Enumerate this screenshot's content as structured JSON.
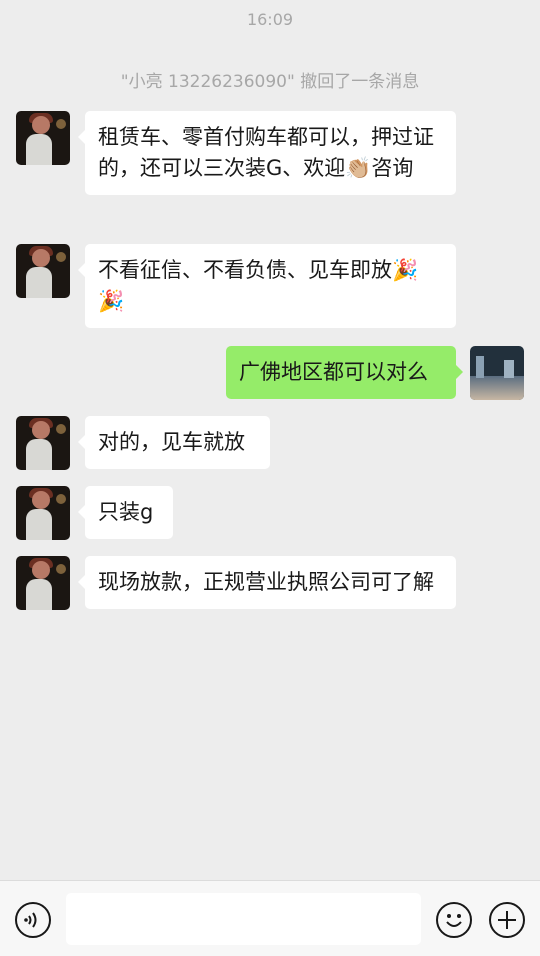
{
  "status": {
    "time": "16:09"
  },
  "system_notice": "\"小亮 13226236090\" 撤回了一条消息",
  "messages": [
    {
      "side": "in",
      "text": "租赁车、零首付购车都可以，押过证的，还可以三次装G、欢迎👏🏼咨询"
    },
    {
      "side": "in",
      "text": "不看征信、不看负债、见车即放🎉🎉"
    },
    {
      "side": "out",
      "text": "广佛地区都可以对么"
    },
    {
      "side": "in",
      "text": "对的，见车就放"
    },
    {
      "side": "in",
      "text": "只装g"
    },
    {
      "side": "in",
      "text": "现场放款，正规营业执照公司可了解"
    }
  ],
  "input": {
    "value": "",
    "placeholder": ""
  },
  "icons": {
    "voice": "voice-icon",
    "emoji": "emoji-icon",
    "plus": "plus-icon"
  },
  "colors": {
    "background": "#ededed",
    "incoming_bubble": "#ffffff",
    "outgoing_bubble": "#95ec69",
    "meta_text": "#a7a7a7"
  }
}
